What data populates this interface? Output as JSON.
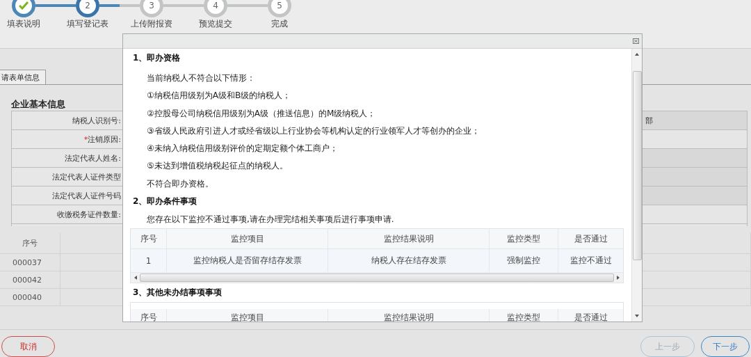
{
  "steps": [
    {
      "label": "填表说明",
      "completed": true,
      "selected": false
    },
    {
      "number": "2",
      "label": "填写登记表",
      "completed": false,
      "selected": true
    },
    {
      "number": "3",
      "label": "上传附报资",
      "completed": false,
      "selected": false
    },
    {
      "number": "4",
      "label": "预览提交",
      "completed": false,
      "selected": false
    },
    {
      "number": "5",
      "label": "完成",
      "completed": false,
      "selected": false
    }
  ],
  "tab": {
    "label": "请表单信息",
    "selected": true
  },
  "form": {
    "title": "企业基本信息",
    "rows": [
      {
        "label": "纳税人识别号:",
        "editable": false,
        "column_3": "部"
      },
      {
        "required_mark": "*",
        "label": "注销原因:",
        "editable": true
      },
      {
        "label": "法定代表人姓名:",
        "editable": false
      },
      {
        "label": "法定代表人证件类型",
        "editable": false
      },
      {
        "label": "法定代表人证件号码",
        "editable": false
      },
      {
        "label": "收缴税务证件数量:",
        "editable": true
      }
    ]
  },
  "list": {
    "columns": [
      "序号"
    ],
    "rows": [
      "000037",
      "000042",
      "000040"
    ]
  },
  "footer": {
    "cancel": "取消",
    "prev": {
      "label": "上一步",
      "disabled": true
    },
    "next": {
      "label": "下一步",
      "disabled": false
    }
  },
  "dialog": {
    "sections": [
      {
        "kind": "text",
        "title": "1、即办资格",
        "paragraphs": [
          "当前纳税人不符合以下情形：",
          "①纳税信用级别为A级和B级的纳税人；",
          "②控股母公司纳税信用级别为A级（推送信息）的M级纳税人；",
          "③省级人民政府引进人才或经省级以上行业协会等机构认定的行业领军人才等创办的企业；",
          "④未纳入纳税信用级别评价的定期定额个体工商户；",
          "⑤未达到增值税纳税起征点的纳税人。",
          "不符合即办资格。"
        ]
      },
      {
        "kind": "table",
        "title": "2、即办条件事项",
        "intro": "您存在以下监控不通过事项,请在办理完结相关事项后进行事项申请.",
        "columns": [
          "序号",
          "监控项目",
          "监控结果说明",
          "监控类型",
          "是否通过"
        ],
        "rows": [
          [
            "1",
            "监控纳税人是否留存结存发票",
            "纳税人存在结存发票",
            "强制监控",
            "监控不通过"
          ]
        ],
        "hscroll": true
      },
      {
        "kind": "table",
        "title": "3、其他未办结事项事项",
        "columns": [
          "序号",
          "监控项目",
          "监控结果说明",
          "监控类型",
          "是否通过"
        ]
      }
    ]
  }
}
